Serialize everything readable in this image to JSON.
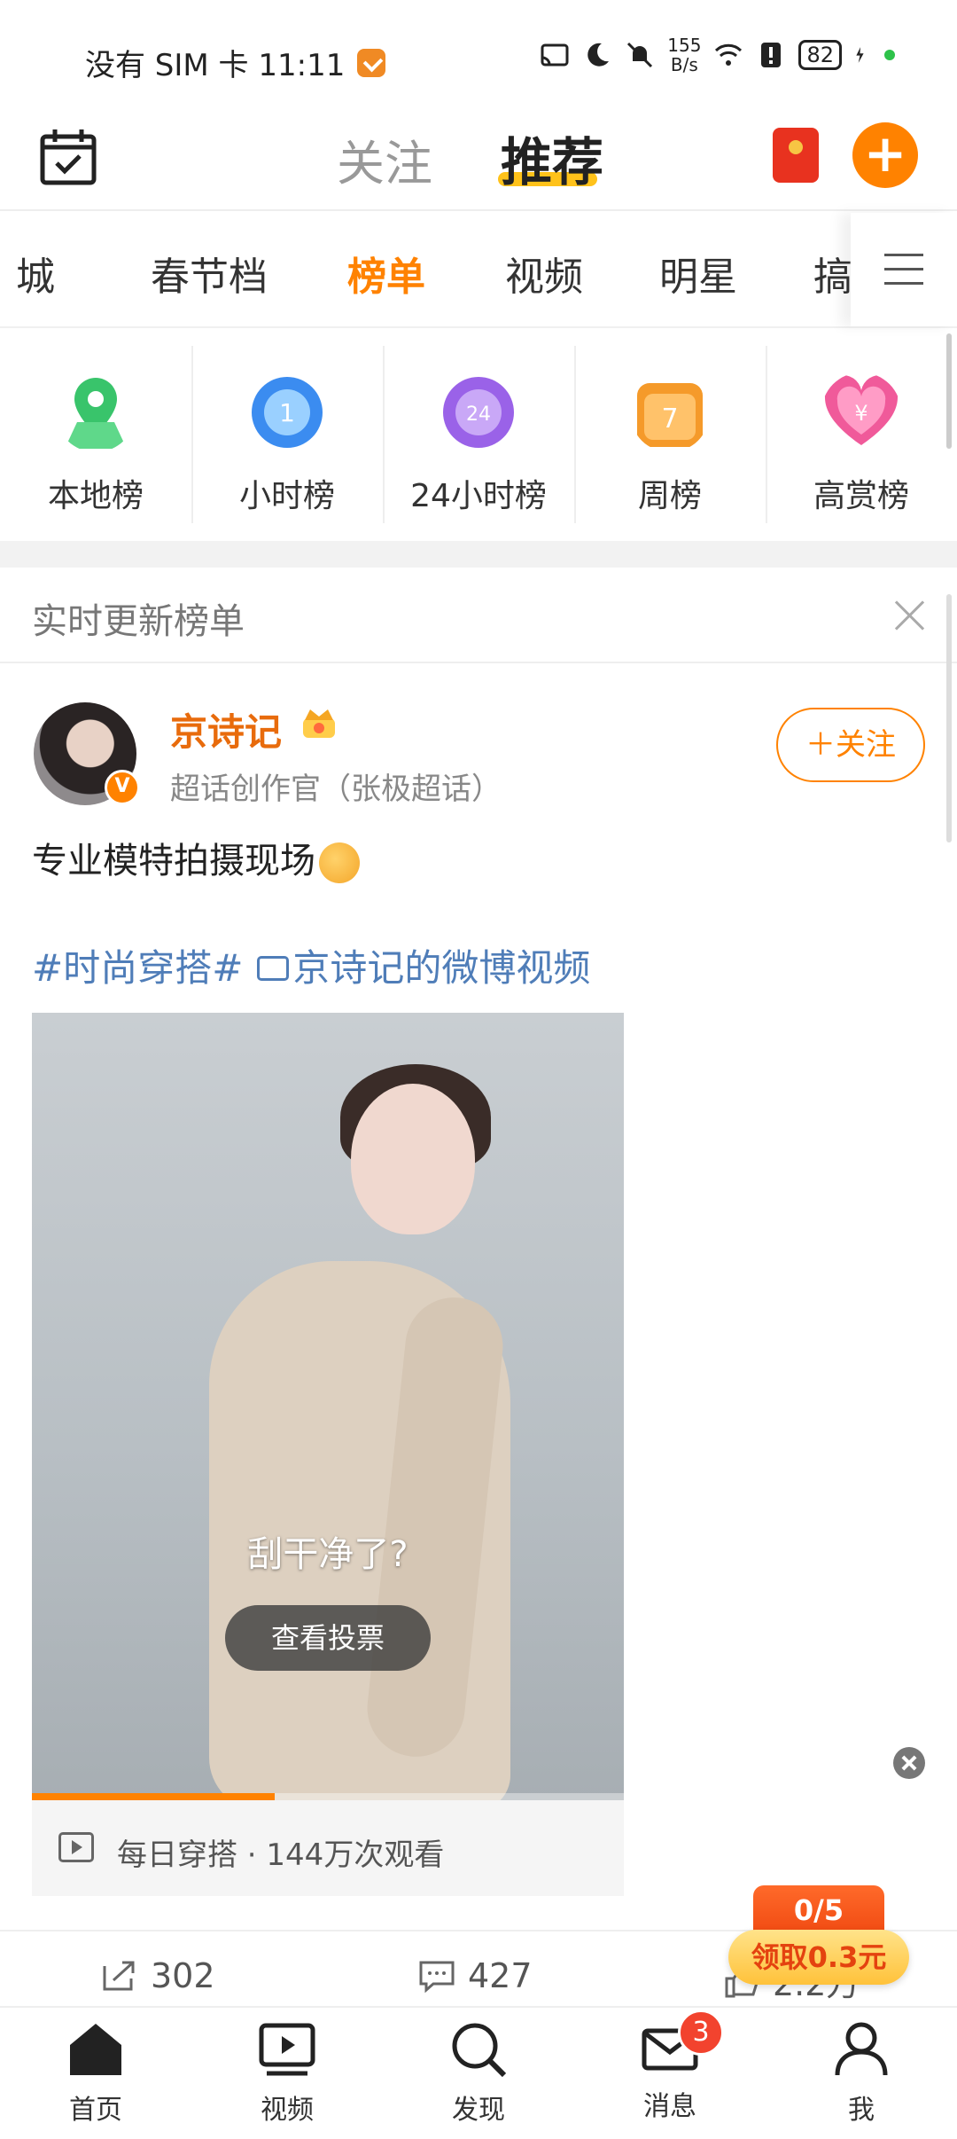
{
  "status_bar": {
    "carrier_time": "没有 SIM 卡 11:11",
    "net_speed_value": "155",
    "net_speed_unit": "B/s",
    "battery": "82",
    "icons": [
      "cast-icon",
      "moon-icon",
      "mute-icon",
      "wifi-icon",
      "alert-icon",
      "battery-icon",
      "charging-icon"
    ]
  },
  "top_nav": {
    "tabs": [
      {
        "label": "关注",
        "active": false
      },
      {
        "label": "推荐",
        "active": true
      }
    ],
    "accent_color": "#ff8200"
  },
  "categories": {
    "items": [
      {
        "label": "城",
        "active": false
      },
      {
        "label": "春节档",
        "active": false
      },
      {
        "label": "榜单",
        "active": true
      },
      {
        "label": "视频",
        "active": false
      },
      {
        "label": "明星",
        "active": false
      },
      {
        "label": "搞",
        "active": false
      }
    ]
  },
  "rankings": [
    {
      "label": "本地榜",
      "icon": "map-pin-icon",
      "color": "#39c46b"
    },
    {
      "label": "小时榜",
      "icon": "clock-1-icon",
      "color": "#3b8cf0"
    },
    {
      "label": "24小时榜",
      "icon": "clock-24-icon",
      "color": "#9a62e8"
    },
    {
      "label": "周榜",
      "icon": "calendar-7-icon",
      "color": "#f59a2a"
    },
    {
      "label": "高赏榜",
      "icon": "heart-yen-icon",
      "color": "#f05a9a"
    }
  ],
  "realtime": {
    "title": "实时更新榜单"
  },
  "post": {
    "author": "京诗记",
    "subtitle": "超话创作官（张极超话）",
    "follow_label": "＋关注",
    "text": "专业模特拍摄现场",
    "tag": "#时尚穿搭#",
    "video_link": "京诗记的微博视频",
    "video": {
      "caption": "刮干净了?",
      "vote_label": "查看投票",
      "progress": 0.41
    },
    "video_meta": "每日穿搭 · 144万次观看",
    "actions": {
      "share_count": "302",
      "comment_count": "427",
      "like_count": "2.2万"
    }
  },
  "reward": {
    "progress": "0/5",
    "claim_label": "领取0.3元"
  },
  "bottom_nav": {
    "items": [
      {
        "label": "首页",
        "icon": "home-icon",
        "active": true
      },
      {
        "label": "视频",
        "icon": "video-icon",
        "active": false
      },
      {
        "label": "发现",
        "icon": "search-icon",
        "active": false
      },
      {
        "label": "消息",
        "icon": "mail-icon",
        "active": false,
        "badge": "3"
      },
      {
        "label": "我",
        "icon": "profile-icon",
        "active": false
      }
    ]
  }
}
